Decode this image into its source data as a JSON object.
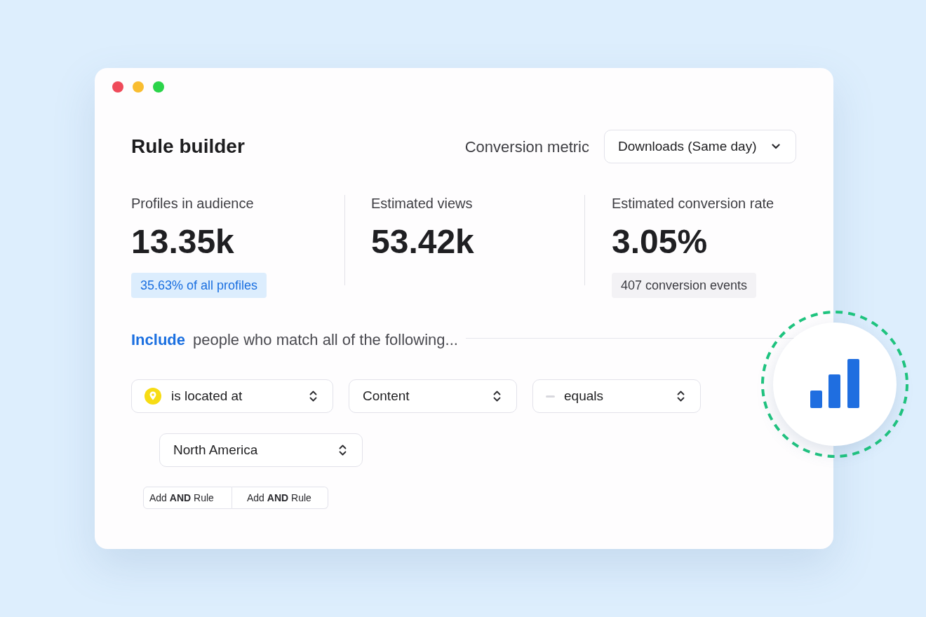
{
  "window": {
    "title": "Rule builder"
  },
  "conversion_metric": {
    "label": "Conversion metric",
    "value": "Downloads (Same day)"
  },
  "stats": [
    {
      "label": "Profiles in audience",
      "value": "13.35k",
      "badge": {
        "text": "35.63% of all profiles",
        "kind": "highlight"
      }
    },
    {
      "label": "Estimated views",
      "value": "53.42k"
    },
    {
      "label": "Estimated conversion rate",
      "value": "3.05%",
      "badge": {
        "text": "407 conversion events",
        "kind": "neutral"
      }
    }
  ],
  "include": {
    "keyword": "Include",
    "text": "people who match all of the following..."
  },
  "rules": [
    [
      {
        "kind": "location",
        "value": "is located at"
      },
      {
        "kind": "field",
        "value": "Content"
      },
      {
        "kind": "operator",
        "value": "equals"
      }
    ],
    [
      {
        "kind": "field",
        "value": "North America"
      }
    ]
  ],
  "add_buttons": [
    "Add **AND** Rule",
    "Add **AND** Rule"
  ]
}
